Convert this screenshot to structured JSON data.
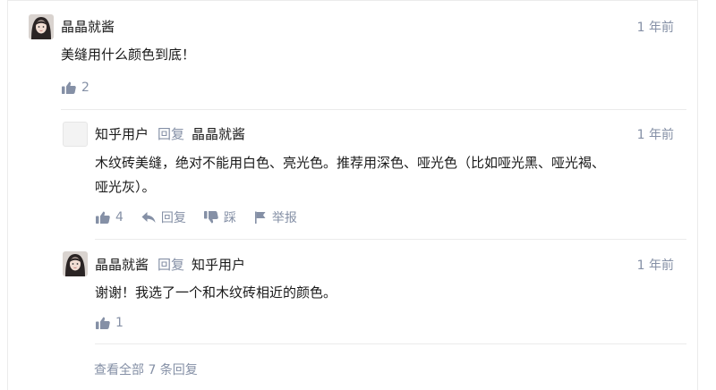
{
  "colors": {
    "meta": "#8590a6",
    "text": "#1a1a1a",
    "divider": "#ebebeb"
  },
  "comments": [
    {
      "author": "晶晶就酱",
      "time": "1 年前",
      "text_lines": [
        "美缝用什么颜色到底！"
      ],
      "likes": "2",
      "avatar": "girl-avatar"
    },
    {
      "author": "知乎用户",
      "reply_word": "回复",
      "reply_to": "晶晶就酱",
      "time": "1 年前",
      "text_lines": [
        "木纹砖美缝，绝对不能用白色、亮光色。推荐用深色、哑光色（比如哑光黑、哑光褐、",
        "哑光灰）。"
      ],
      "likes": "4",
      "reply_label": "回复",
      "dislike_label": "踩",
      "report_label": "举报",
      "avatar": "blank-avatar"
    },
    {
      "author": "晶晶就酱",
      "reply_word": "回复",
      "reply_to": "知乎用户",
      "time": "1 年前",
      "text_lines": [
        "谢谢！我选了一个和木纹砖相近的颜色。"
      ],
      "likes": "1",
      "avatar": "girl-avatar"
    }
  ],
  "view_all": "查看全部 7 条回复"
}
